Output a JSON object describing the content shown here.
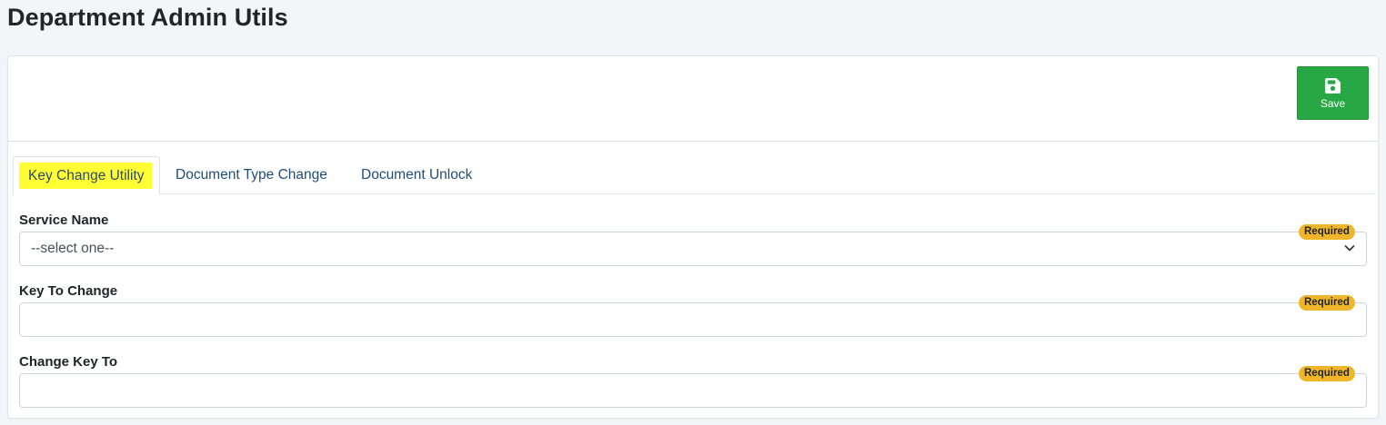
{
  "page": {
    "title": "Department Admin Utils"
  },
  "toolbar": {
    "save_label": "Save",
    "save_icon": "floppy-disk-icon",
    "save_color": "#28a745"
  },
  "tabs": [
    {
      "label": "Key Change Utility",
      "active": true,
      "highlight": "#ffff33"
    },
    {
      "label": "Document Type Change",
      "active": false
    },
    {
      "label": "Document Unlock",
      "active": false
    }
  ],
  "form": {
    "service_name": {
      "label": "Service Name",
      "selected": "--select one--",
      "badge": "Required"
    },
    "key_to_change": {
      "label": "Key To Change",
      "value": "",
      "badge": "Required"
    },
    "change_key_to": {
      "label": "Change Key To",
      "value": "",
      "badge": "Required"
    }
  },
  "colors": {
    "tab_text": "#1f4e79",
    "required_badge": "#f0b629"
  }
}
